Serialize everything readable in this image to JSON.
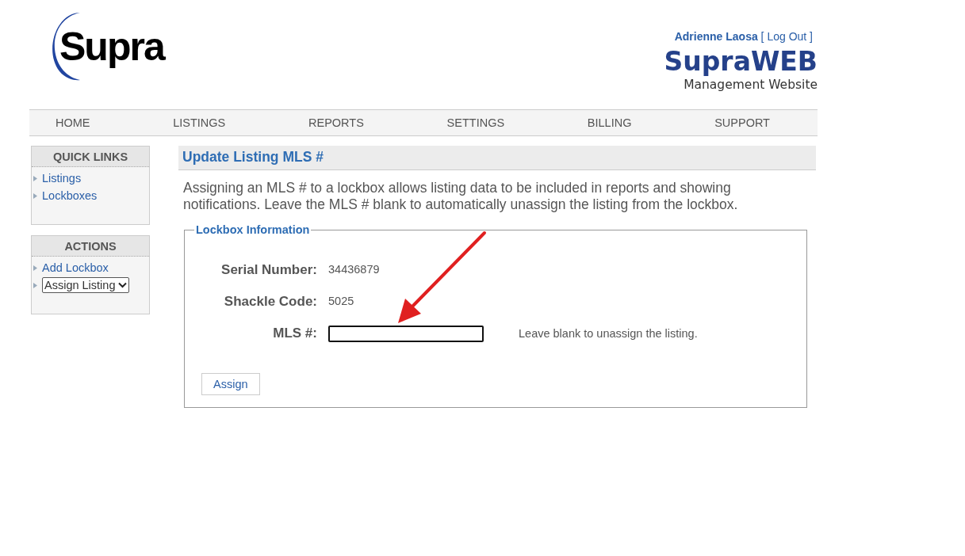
{
  "header": {
    "logo": "Supra",
    "user": "Adrienne Laosa",
    "logout": "Log Out",
    "logout_open": "[",
    "logout_close": "]",
    "site_title": "SupraWEB",
    "site_subtitle": "Management Website"
  },
  "nav": [
    "HOME",
    "LISTINGS",
    "REPORTS",
    "SETTINGS",
    "BILLING",
    "SUPPORT"
  ],
  "sidebar": [
    {
      "title": "QUICK LINKS",
      "items": [
        {
          "kind": "link",
          "label": "Listings"
        },
        {
          "kind": "link",
          "label": "Lockboxes"
        }
      ]
    },
    {
      "title": "ACTIONS",
      "items": [
        {
          "kind": "link",
          "label": "Add Lockbox"
        },
        {
          "kind": "select",
          "label": "Assign Listing"
        }
      ]
    }
  ],
  "main": {
    "title": "Update Listing MLS #",
    "description": "Assigning an MLS # to a lockbox allows listing data to be included in reports and showing notifications. Leave the MLS # blank to automatically unassign the listing from the lockbox.",
    "fieldset": {
      "legend": "Lockbox Information",
      "fields": [
        {
          "kind": "text",
          "label": "Serial Number:",
          "value": "34436879"
        },
        {
          "kind": "text",
          "label": "Shackle Code:",
          "value": "5025"
        },
        {
          "kind": "input",
          "label": "MLS #:",
          "hint": "Leave blank to unassign the listing."
        }
      ],
      "button": "Assign"
    }
  }
}
